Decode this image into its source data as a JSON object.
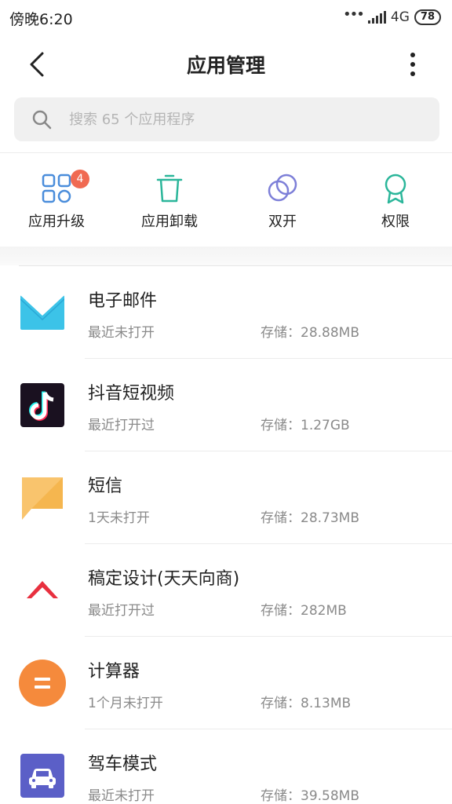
{
  "status_bar": {
    "time": "傍晚6:20",
    "network": "4G",
    "battery": "78",
    "icons": [
      "more-dots-icon",
      "signal-icon",
      "battery-icon"
    ]
  },
  "header": {
    "title": "应用管理",
    "icons": [
      "back-arrow-icon",
      "more-vertical-icon"
    ]
  },
  "search": {
    "placeholder": "搜索 65 个应用程序",
    "value": "",
    "icon": "search-icon"
  },
  "quick_actions": [
    {
      "label": "应用升级",
      "icon": "grid-apps-icon",
      "badge": "4"
    },
    {
      "label": "应用卸载",
      "icon": "trash-icon"
    },
    {
      "label": "双开",
      "icon": "dual-circles-icon"
    },
    {
      "label": "权限",
      "icon": "award-ribbon-icon"
    }
  ],
  "colors": {
    "accent_blue": "#4a8ddb",
    "accent_teal": "#2bb69a",
    "accent_purple": "#7d7fd8",
    "badge": "#f06a52"
  },
  "apps": [
    {
      "name": "电子邮件",
      "last_used": "最近未打开",
      "storage": "存储：28.88MB",
      "icon": "email-app-icon"
    },
    {
      "name": "抖音短视频",
      "last_used": "最近打开过",
      "storage": "存储：1.27GB",
      "icon": "douyin-app-icon"
    },
    {
      "name": "短信",
      "last_used": "1天未打开",
      "storage": "存储：28.73MB",
      "icon": "messages-app-icon"
    },
    {
      "name": "稿定设计(天天向商)",
      "last_used": "最近打开过",
      "storage": "存储：282MB",
      "icon": "gaoding-app-icon"
    },
    {
      "name": "计算器",
      "last_used": "1个月未打开",
      "storage": "存储：8.13MB",
      "icon": "calculator-app-icon"
    },
    {
      "name": "驾车模式",
      "last_used": "最近未打开",
      "storage": "存储：39.58MB",
      "icon": "driving-mode-app-icon"
    }
  ]
}
